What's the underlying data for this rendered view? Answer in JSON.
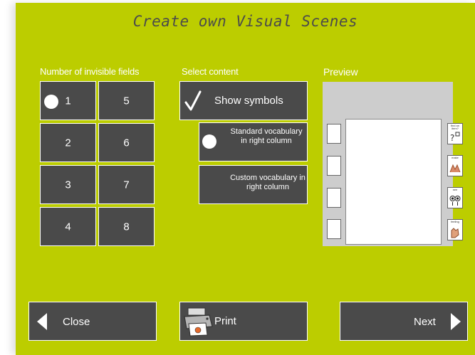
{
  "title": "Create own Visual Scenes",
  "fields_section": {
    "label": "Number of invisible fields",
    "options": [
      "1",
      "2",
      "3",
      "4",
      "5",
      "6",
      "7",
      "8"
    ],
    "selected": "1"
  },
  "content_section": {
    "label": "Select content",
    "show_symbols": "Show symbols",
    "standard_vocab": "Standard vocabulary in right column",
    "custom_vocab": "Custom vocabulary in right column"
  },
  "preview": {
    "label": "Preview",
    "symbols": [
      {
        "caption": "find an item?",
        "icon": "question-icon"
      },
      {
        "caption": "make",
        "icon": "hands-icon"
      },
      {
        "caption": "see",
        "icon": "eyes-icon"
      },
      {
        "caption": "feeling",
        "icon": "hand-icon"
      }
    ]
  },
  "footer": {
    "close_label": "Close",
    "print_label": "Print",
    "next_label": "Next"
  },
  "colors": {
    "background": "#bccd00",
    "button": "#4a4a4a",
    "text": "#ffffff"
  }
}
